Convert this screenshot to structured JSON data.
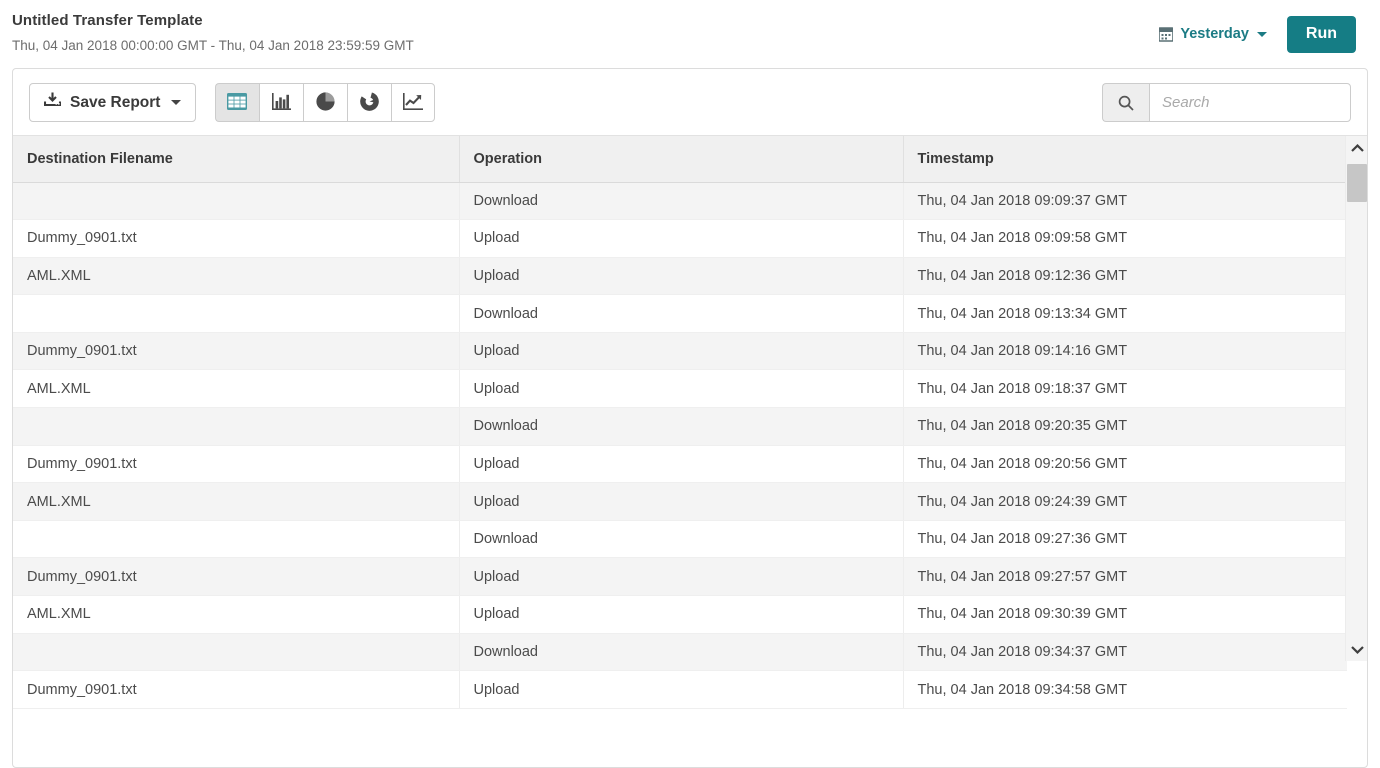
{
  "header": {
    "title": "Untitled Transfer Template",
    "subtitle": "Thu, 04 Jan 2018 00:00:00 GMT - Thu, 04 Jan 2018 23:59:59 GMT",
    "date_range_label": "Yesterday",
    "run_label": "Run",
    "accent_color": "#157d85",
    "calendar_icon": "calendar-icon",
    "caret_icon": "chevron-down-icon"
  },
  "toolbar": {
    "save_report_label": "Save Report",
    "save_report_icon": "download-icon",
    "views": [
      {
        "name": "table",
        "icon": "table-grid-icon",
        "active": true
      },
      {
        "name": "bar",
        "icon": "bar-chart-icon",
        "active": false
      },
      {
        "name": "pie",
        "icon": "pie-chart-icon",
        "active": false
      },
      {
        "name": "donut",
        "icon": "donut-chart-icon",
        "active": false
      },
      {
        "name": "line",
        "icon": "line-chart-icon",
        "active": false
      }
    ],
    "search": {
      "placeholder": "Search",
      "value": "",
      "icon": "search-icon"
    }
  },
  "table": {
    "columns": [
      "Destination Filename",
      "Operation",
      "Timestamp"
    ],
    "rows": [
      {
        "filename": "",
        "operation": "Download",
        "timestamp": "Thu, 04 Jan 2018 09:09:37 GMT"
      },
      {
        "filename": "Dummy_0901.txt",
        "operation": "Upload",
        "timestamp": "Thu, 04 Jan 2018 09:09:58 GMT"
      },
      {
        "filename": "AML.XML",
        "operation": "Upload",
        "timestamp": "Thu, 04 Jan 2018 09:12:36 GMT"
      },
      {
        "filename": "",
        "operation": "Download",
        "timestamp": "Thu, 04 Jan 2018 09:13:34 GMT"
      },
      {
        "filename": "Dummy_0901.txt",
        "operation": "Upload",
        "timestamp": "Thu, 04 Jan 2018 09:14:16 GMT"
      },
      {
        "filename": "AML.XML",
        "operation": "Upload",
        "timestamp": "Thu, 04 Jan 2018 09:18:37 GMT"
      },
      {
        "filename": "",
        "operation": "Download",
        "timestamp": "Thu, 04 Jan 2018 09:20:35 GMT"
      },
      {
        "filename": "Dummy_0901.txt",
        "operation": "Upload",
        "timestamp": "Thu, 04 Jan 2018 09:20:56 GMT"
      },
      {
        "filename": "AML.XML",
        "operation": "Upload",
        "timestamp": "Thu, 04 Jan 2018 09:24:39 GMT"
      },
      {
        "filename": "",
        "operation": "Download",
        "timestamp": "Thu, 04 Jan 2018 09:27:36 GMT"
      },
      {
        "filename": "Dummy_0901.txt",
        "operation": "Upload",
        "timestamp": "Thu, 04 Jan 2018 09:27:57 GMT"
      },
      {
        "filename": "AML.XML",
        "operation": "Upload",
        "timestamp": "Thu, 04 Jan 2018 09:30:39 GMT"
      },
      {
        "filename": "",
        "operation": "Download",
        "timestamp": "Thu, 04 Jan 2018 09:34:37 GMT"
      },
      {
        "filename": "Dummy_0901.txt",
        "operation": "Upload",
        "timestamp": "Thu, 04 Jan 2018 09:34:58 GMT"
      }
    ]
  },
  "scrollbar": {
    "up_icon": "chevron-up-icon",
    "down_icon": "chevron-down-icon"
  }
}
